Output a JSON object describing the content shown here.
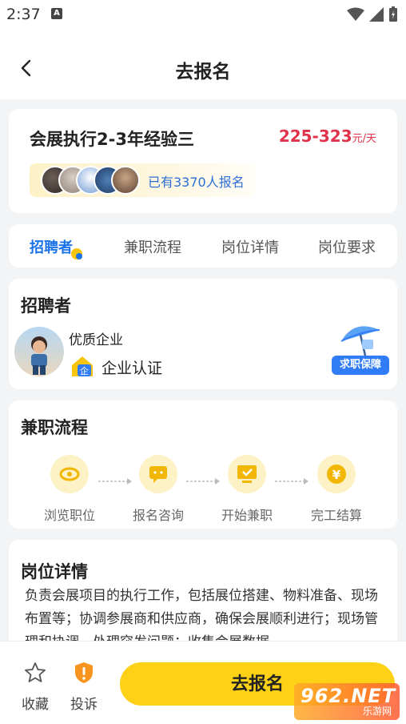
{
  "status_bar": {
    "time": "2:37",
    "notification_icon": "A"
  },
  "header": {
    "title": "去报名",
    "back_icon": "chevron-left-icon"
  },
  "job": {
    "title": "会展执行2-3年经验三",
    "salary": "225-323",
    "salary_unit": "元/天",
    "signup_count_text": "已有3370人报名"
  },
  "tabs": [
    {
      "label": "招聘者",
      "active": true
    },
    {
      "label": "兼职流程",
      "active": false
    },
    {
      "label": "岗位详情",
      "active": false
    },
    {
      "label": "岗位要求",
      "active": false
    }
  ],
  "recruiter": {
    "section_title": "招聘者",
    "company_name": "优质企业",
    "verify_label": "企业认证",
    "guarantee_label": "求职保障"
  },
  "process": {
    "section_title": "兼职流程",
    "steps": [
      {
        "label": "浏览职位",
        "icon": "eye-icon"
      },
      {
        "label": "报名咨询",
        "icon": "chat-icon"
      },
      {
        "label": "开始兼职",
        "icon": "monitor-check-icon"
      },
      {
        "label": "完工结算",
        "icon": "yen-coin-icon"
      }
    ]
  },
  "detail": {
    "section_title": "岗位详情",
    "text": "负责会展项目的执行工作，包括展位搭建、物料准备、现场布置等；协调参展商和供应商，确保会展顺利进行；现场管理和协调，处理突发问题；收集会展数据"
  },
  "bottom_bar": {
    "favorite_label": "收藏",
    "complaint_label": "投诉",
    "apply_label": "去报名"
  },
  "watermark": {
    "main": "962.NET",
    "sub": "乐游网"
  },
  "colors": {
    "accent": "#fcd116",
    "salary": "#e0334b",
    "link": "#2d6fd6",
    "tab_active": "#1a73e8"
  }
}
